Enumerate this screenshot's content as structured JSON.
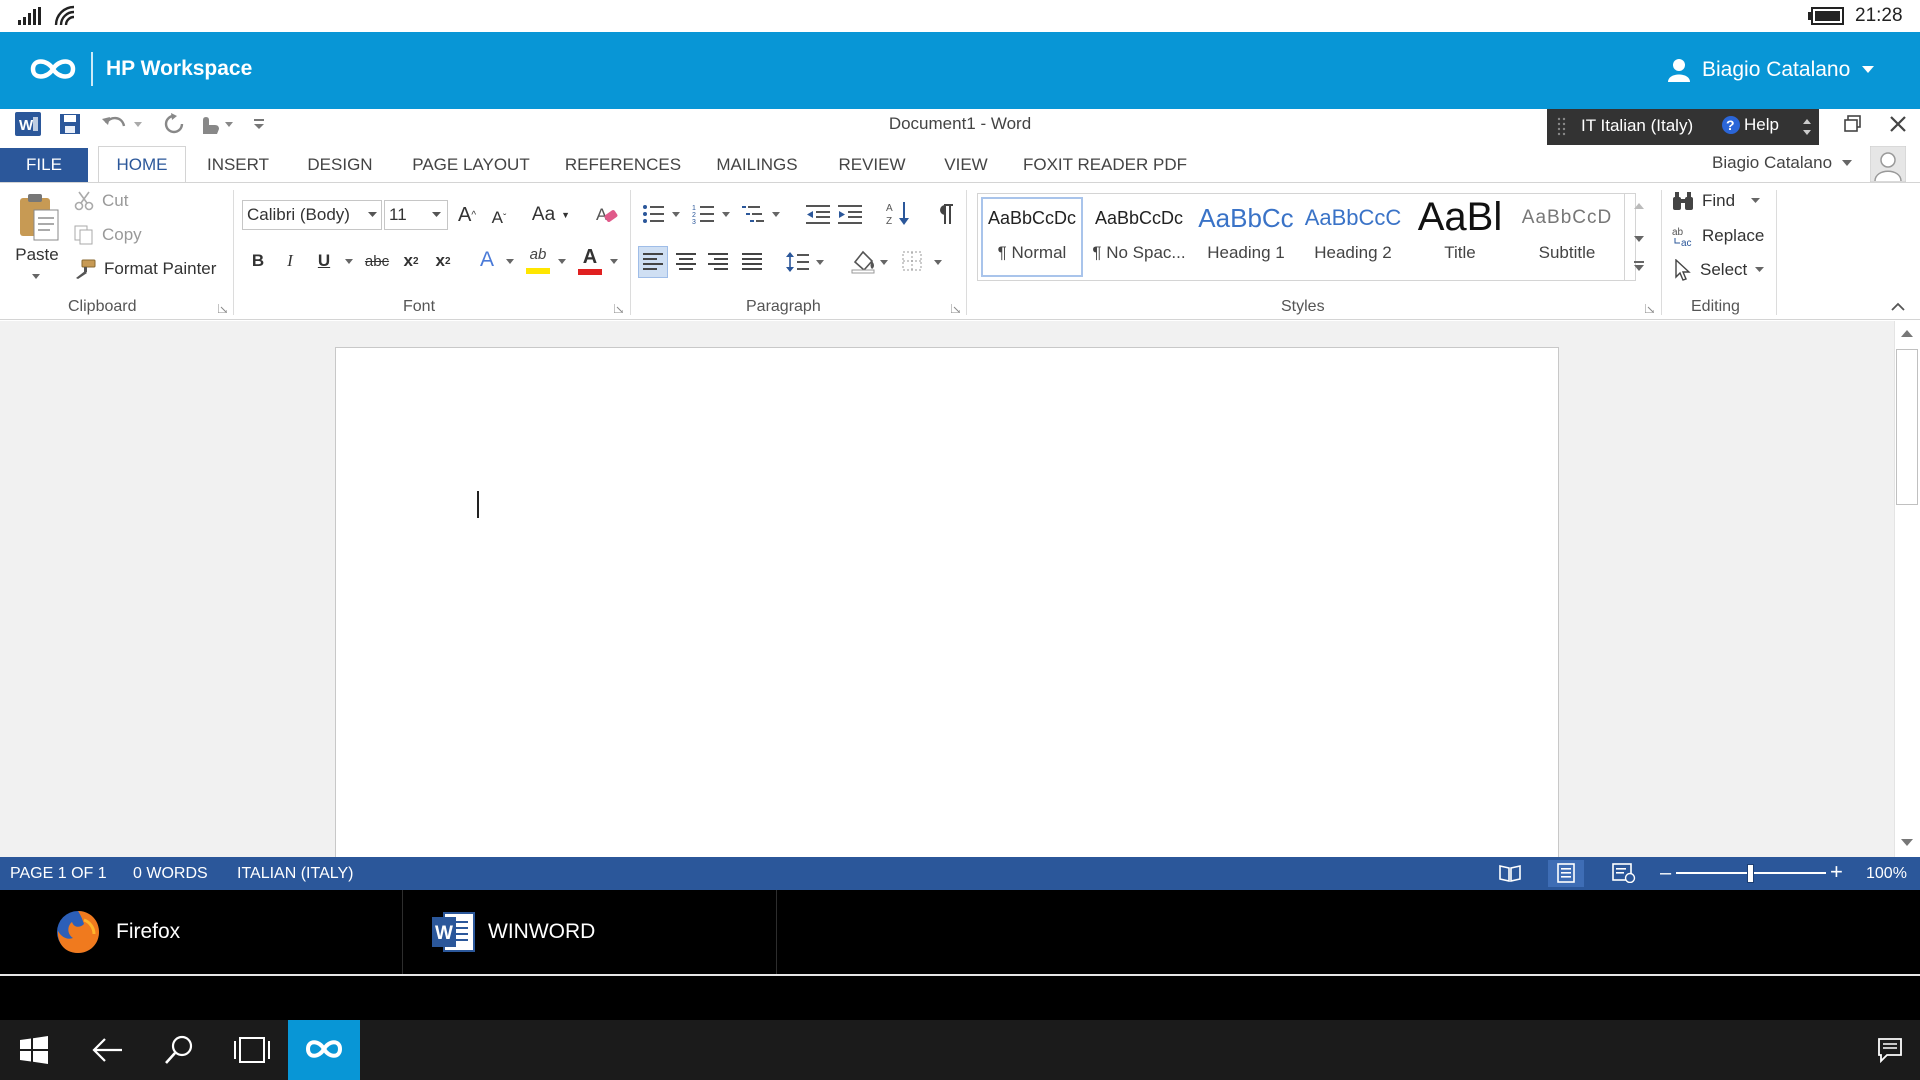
{
  "status_bar": {
    "time": "21:28"
  },
  "hp_bar": {
    "title": "HP Workspace",
    "user": "Biagio Catalano"
  },
  "window": {
    "title": "Document1 - Word",
    "language": "IT  Italian (Italy)",
    "help": "Help"
  },
  "tabs": [
    "FILE",
    "HOME",
    "INSERT",
    "DESIGN",
    "PAGE LAYOUT",
    "REFERENCES",
    "MAILINGS",
    "REVIEW",
    "VIEW",
    "FOXIT READER PDF"
  ],
  "active_tab": "HOME",
  "account": {
    "name": "Biagio Catalano"
  },
  "clipboard": {
    "paste": "Paste",
    "cut": "Cut",
    "copy": "Copy",
    "format_painter": "Format Painter",
    "group": "Clipboard"
  },
  "font": {
    "name": "Calibri (Body)",
    "size": "11",
    "group": "Font",
    "bold": "B",
    "italic": "I",
    "underline": "U",
    "strike": "abc",
    "sub": "x",
    "sub_mark": "2",
    "sup": "x",
    "sup_mark": "2",
    "grow": "A",
    "shrink": "A",
    "case": "Aa",
    "font_color": "A",
    "text_effects": "A",
    "highlight": "ab"
  },
  "paragraph": {
    "group": "Paragraph"
  },
  "styles": {
    "group": "Styles",
    "items": [
      {
        "preview": "AaBbCcDc",
        "name": "¶ Normal"
      },
      {
        "preview": "AaBbCcDc",
        "name": "¶ No Spac..."
      },
      {
        "preview": "AaBbCc",
        "name": "Heading 1"
      },
      {
        "preview": "AaBbCcC",
        "name": "Heading 2"
      },
      {
        "preview": "AaBl",
        "name": "Title"
      },
      {
        "preview": "AaBbCcD",
        "name": "Subtitle"
      }
    ]
  },
  "editing": {
    "find": "Find",
    "replace": "Replace",
    "select": "Select",
    "group": "Editing"
  },
  "status": {
    "page": "PAGE 1 OF 1",
    "words": "0 WORDS",
    "language": "ITALIAN (ITALY)",
    "zoom": "100%"
  },
  "zoom_level": 1.0,
  "taskbar_apps": [
    {
      "label": "Firefox"
    },
    {
      "label": "WINWORD"
    }
  ],
  "colors": {
    "accent": "#0896d6",
    "word_blue": "#2b579a",
    "status_blue": "#2b579a"
  }
}
